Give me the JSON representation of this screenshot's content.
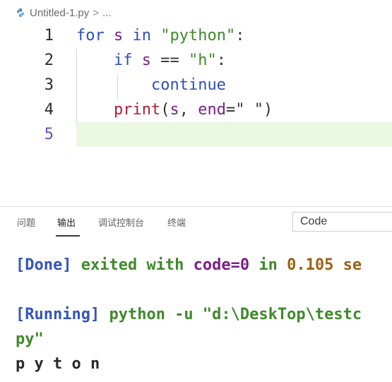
{
  "breadcrumb": {
    "filename": "Untitled-1.py",
    "separator": ">",
    "ellipsis": "..."
  },
  "editor": {
    "current_line": 5,
    "lines": [
      {
        "number": "1",
        "tokens": [
          {
            "t": "for",
            "c": "kw"
          },
          {
            "t": " ",
            "c": "op"
          },
          {
            "t": "s",
            "c": "var"
          },
          {
            "t": " ",
            "c": "op"
          },
          {
            "t": "in",
            "c": "kw"
          },
          {
            "t": " ",
            "c": "op"
          },
          {
            "t": "\"python\"",
            "c": "str"
          },
          {
            "t": ":",
            "c": "op"
          }
        ]
      },
      {
        "number": "2",
        "tokens": [
          {
            "t": "    ",
            "c": "op"
          },
          {
            "t": "if",
            "c": "flow"
          },
          {
            "t": " ",
            "c": "op"
          },
          {
            "t": "s",
            "c": "var"
          },
          {
            "t": " == ",
            "c": "op"
          },
          {
            "t": "\"h\"",
            "c": "str"
          },
          {
            "t": ":",
            "c": "op"
          }
        ]
      },
      {
        "number": "3",
        "tokens": [
          {
            "t": "        ",
            "c": "op"
          },
          {
            "t": "continue",
            "c": "flow"
          }
        ]
      },
      {
        "number": "4",
        "tokens": [
          {
            "t": "    ",
            "c": "op"
          },
          {
            "t": "print",
            "c": "fn"
          },
          {
            "t": "(",
            "c": "op"
          },
          {
            "t": "s",
            "c": "var"
          },
          {
            "t": ", ",
            "c": "op"
          },
          {
            "t": "end",
            "c": "param"
          },
          {
            "t": "=",
            "c": "op"
          },
          {
            "t": "\" \"",
            "c": "op"
          },
          {
            "t": ")",
            "c": "op"
          }
        ]
      },
      {
        "number": "5",
        "tokens": []
      }
    ]
  },
  "panel": {
    "tabs": [
      {
        "label": "问题",
        "active": false
      },
      {
        "label": "输出",
        "active": true
      },
      {
        "label": "调试控制台",
        "active": false
      },
      {
        "label": "终端",
        "active": false
      }
    ],
    "output_channel": "Code"
  },
  "output": {
    "lines": [
      [
        {
          "t": "[Done]",
          "c": "c-blue"
        },
        {
          "t": " exited with ",
          "c": "c-green"
        },
        {
          "t": "code=0",
          "c": "c-purple"
        },
        {
          "t": " in ",
          "c": "c-green"
        },
        {
          "t": "0.105",
          "c": "c-brown"
        },
        {
          "t": " se",
          "c": "c-brown"
        }
      ],
      [],
      [
        {
          "t": "[Running]",
          "c": "c-blue"
        },
        {
          "t": " python -u \"d:\\DeskTop\\testc",
          "c": "c-green"
        }
      ],
      [
        {
          "t": "py\"",
          "c": "c-green"
        }
      ],
      [
        {
          "t": "p y t o n",
          "c": "c-dark"
        }
      ]
    ]
  }
}
